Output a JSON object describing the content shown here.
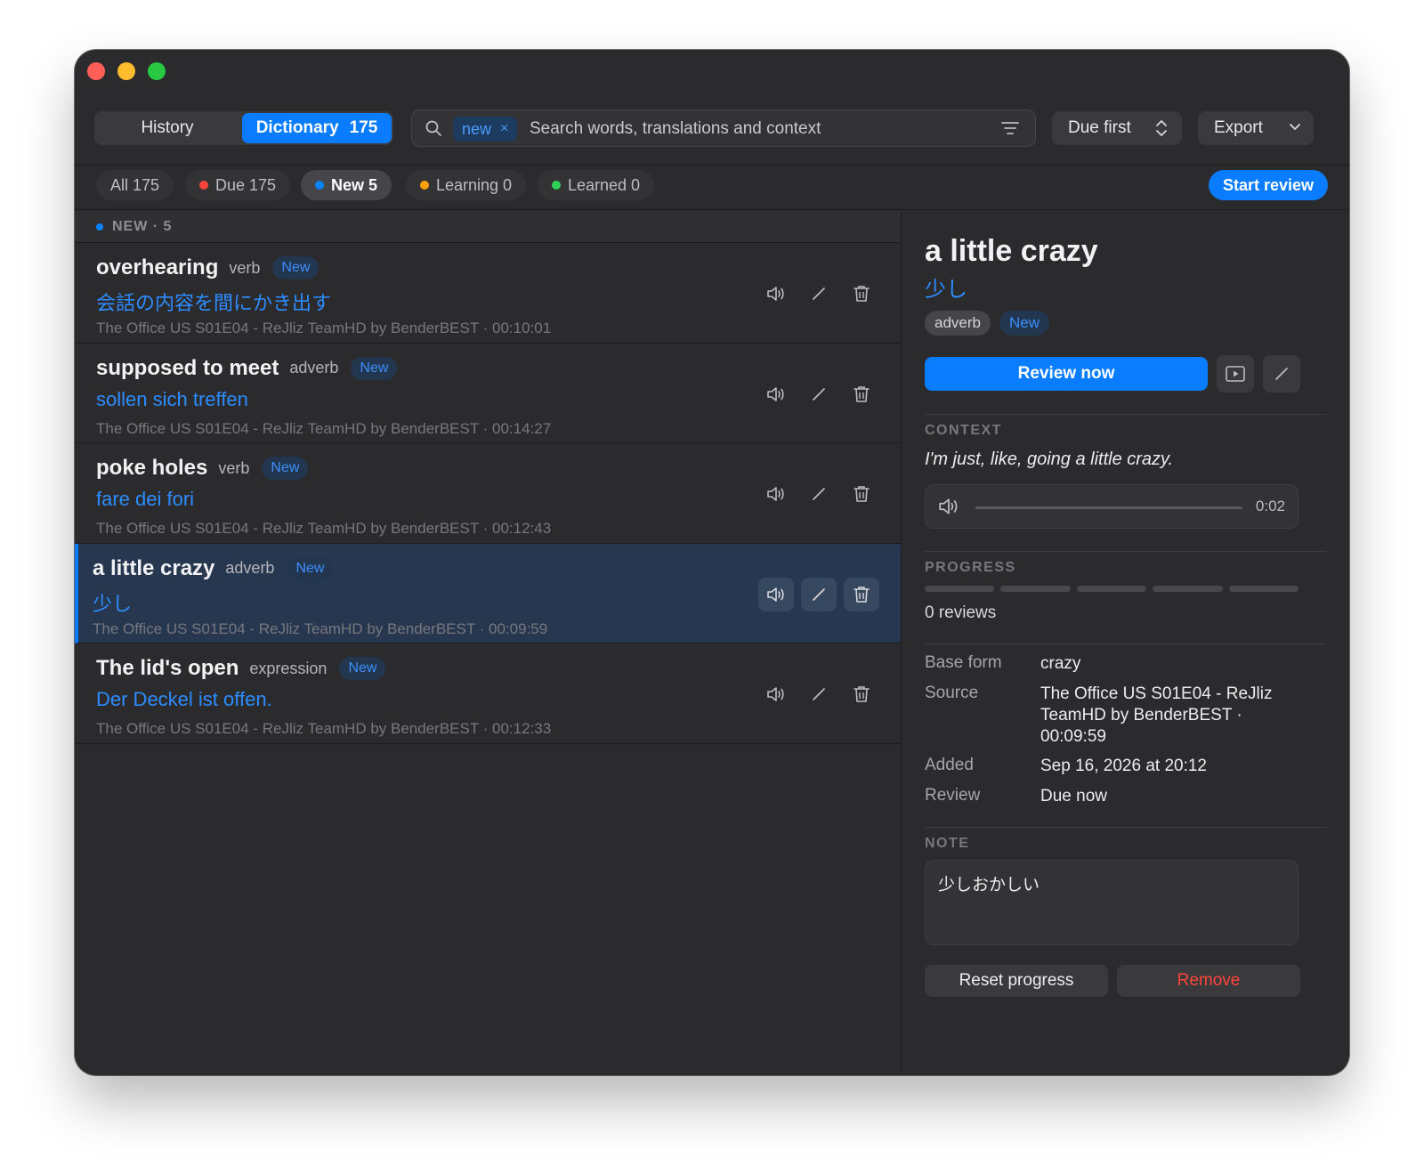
{
  "toolbar": {
    "tabs": [
      {
        "label": "History"
      },
      {
        "label": "Dictionary",
        "count": "175"
      }
    ],
    "search": {
      "chip": "new",
      "chip_remove": "×",
      "placeholder": "Search words, translations and context"
    },
    "sort": {
      "selected": "Due first"
    },
    "export": {
      "label": "Export"
    }
  },
  "filters": {
    "all": "All 175",
    "due": "Due 175",
    "new": "New 5",
    "learning": "Learning 0",
    "learned": "Learned 0",
    "start_review": "Start review"
  },
  "list": {
    "section_header": "NEW · 5",
    "items": [
      {
        "word": "overhearing",
        "pos": "verb",
        "badge": "New",
        "translation": "会話の内容を間にかき出す",
        "source": "The Office US S01E04 - ReJliz TeamHD by BenderBEST · 00:10:01"
      },
      {
        "word": "supposed to meet",
        "pos": "adverb",
        "badge": "New",
        "translation": "sollen sich treffen",
        "source": "The Office US S01E04 - ReJliz TeamHD by BenderBEST · 00:14:27"
      },
      {
        "word": "poke holes",
        "pos": "verb",
        "badge": "New",
        "translation": "fare dei fori",
        "source": "The Office US S01E04 - ReJliz TeamHD by BenderBEST · 00:12:43"
      },
      {
        "word": "a little crazy",
        "pos": "adverb",
        "badge": "New",
        "translation": "少し",
        "source": "The Office US S01E04 - ReJliz TeamHD by BenderBEST · 00:09:59"
      },
      {
        "word": "The lid's open",
        "pos": "expression",
        "badge": "New",
        "translation": "Der Deckel ist offen.",
        "source": "The Office US S01E04 - ReJliz TeamHD by BenderBEST · 00:12:33"
      }
    ]
  },
  "detail": {
    "title": "a little crazy",
    "translation": "少し",
    "tags": [
      "adverb",
      "New"
    ],
    "review_now": "Review now",
    "context_label": "CONTEXT",
    "context_text": "I'm just, like, going a little crazy.",
    "audio_time": "0:02",
    "progress_label": "PROGRESS",
    "progress_steps_total": 5,
    "progress_steps_done": 0,
    "reviews": "0 reviews",
    "fields": {
      "base_form_label": "Base form",
      "base_form": "crazy",
      "source_label": "Source",
      "source": "The Office US S01E04 - ReJliz TeamHD by BenderBEST · 00:09:59",
      "added_label": "Added",
      "added": "Sep 16, 2026 at 20:12",
      "review_label": "Review",
      "review": "Due now"
    },
    "note_label": "NOTE",
    "note": "少しおかしい",
    "reset_progress": "Reset progress",
    "remove": "Remove"
  },
  "colors": {
    "accent": "#0a7cff",
    "danger": "#ff453a",
    "due_dot": "#ff453a",
    "new_dot": "#0a84ff",
    "learning_dot": "#ff9f0a",
    "learned_dot": "#30d158"
  },
  "icons": [
    "search-icon",
    "filter-lines-icon",
    "updown-chevron-icon",
    "chevron-down-icon",
    "speaker-icon",
    "pencil-icon",
    "trash-icon",
    "play-video-icon"
  ]
}
